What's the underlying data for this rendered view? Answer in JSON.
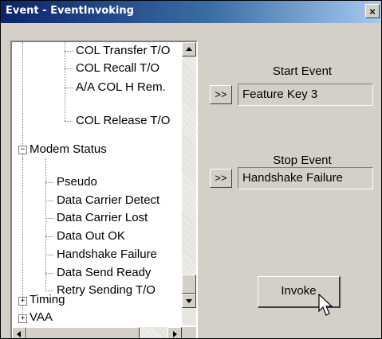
{
  "window": {
    "title": "Event - EventInvoking",
    "close_glyph": "×"
  },
  "tree": {
    "items": [
      {
        "label": "COL Transfer T/O"
      },
      {
        "label": "COL Recall T/O"
      },
      {
        "label": "A/A COL H Rem."
      },
      {
        "label": "COL Release T/O"
      },
      {
        "label": "Modem Status",
        "toggle": "−"
      },
      {
        "label": "Pseudo"
      },
      {
        "label": "Data Carrier Detect"
      },
      {
        "label": "Data Carrier Lost"
      },
      {
        "label": "Data Out OK"
      },
      {
        "label": "Handshake Failure"
      },
      {
        "label": "Data Send Ready"
      },
      {
        "label": "Retry Sending T/O"
      },
      {
        "label": "Timing",
        "toggle": "+"
      },
      {
        "label": "VAA",
        "toggle": "+"
      }
    ]
  },
  "start_event": {
    "label": "Start Event",
    "button": ">>",
    "value": "Feature Key 3"
  },
  "stop_event": {
    "label": "Stop Event",
    "button": ">>",
    "value": "Handshake Failure"
  },
  "invoke": {
    "label": "Invoke"
  },
  "icons": [
    "close-icon",
    "scroll-up-arrow-icon",
    "scroll-down-arrow-icon",
    "scroll-left-arrow-icon",
    "scroll-right-arrow-icon",
    "mouse-pointer-icon"
  ]
}
